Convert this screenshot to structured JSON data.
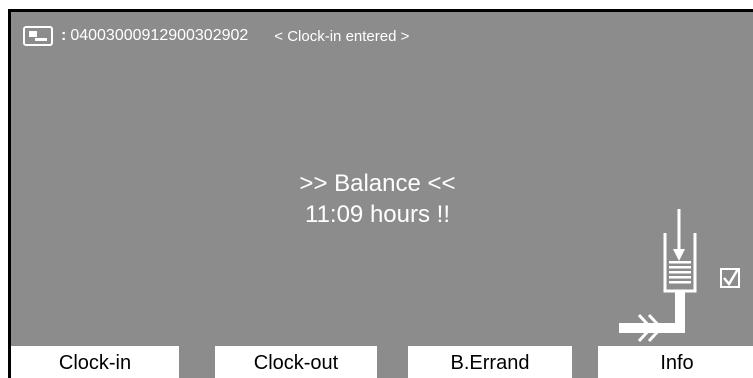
{
  "status_bar": {
    "card_icon": "card-reader-icon",
    "separator": ":",
    "card_number": "04003000912900302902",
    "message": "< Clock-in entered >"
  },
  "main_message": {
    "line1": ">> Balance <<",
    "line2": "11:09 hours !!"
  },
  "terminal_icon": "terminal-insert-card-icon",
  "checkbox_icon": "checked-box-icon",
  "softkeys": [
    {
      "label": "Clock-in"
    },
    {
      "label": "Clock-out"
    },
    {
      "label": "B.Errand"
    },
    {
      "label": "Info"
    }
  ],
  "colors": {
    "screen_background": "#8c8c8c",
    "text": "#ffffff",
    "softkey_background": "#ffffff",
    "softkey_text": "#000000"
  }
}
